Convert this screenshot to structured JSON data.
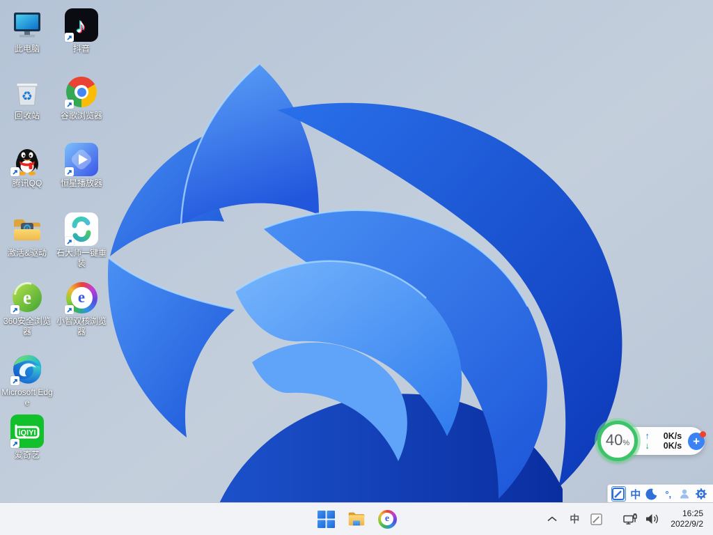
{
  "desktop": {
    "icons": [
      {
        "id": "this-pc",
        "label": "此电脑",
        "shortcut": false
      },
      {
        "id": "douyin",
        "label": "抖音",
        "shortcut": true
      },
      {
        "id": "recycle-bin",
        "label": "回收站",
        "shortcut": false
      },
      {
        "id": "chrome",
        "label": "谷歌浏览器",
        "shortcut": true
      },
      {
        "id": "qq",
        "label": "腾讯QQ",
        "shortcut": true
      },
      {
        "id": "star-player",
        "label": "恒星播放器",
        "shortcut": true
      },
      {
        "id": "activation-driver",
        "label": "激活&驱动",
        "shortcut": false
      },
      {
        "id": "shidashi",
        "label": "石大师一键重装",
        "shortcut": true
      },
      {
        "id": "360-browser",
        "label": "360安全浏览器",
        "shortcut": true,
        "glyph": "e"
      },
      {
        "id": "xiaozhi-browser",
        "label": "小智双核浏览器",
        "shortcut": true,
        "glyph": "e"
      },
      {
        "id": "edge",
        "label": "Microsoft Edge",
        "shortcut": true
      },
      {
        "id": "iqiyi",
        "label": "爱奇艺",
        "shortcut": true,
        "glyph": "iQIYI"
      }
    ]
  },
  "speed_widget": {
    "percent": "40",
    "unit": "%",
    "upload_arrow": "↑",
    "download_arrow": "↓",
    "upload_speed": "0K/s",
    "download_speed": "0K/s",
    "plus_label": "+"
  },
  "ime_bar": {
    "mode_chinese": "中",
    "punctuation": "°,"
  },
  "taskbar": {
    "browser_glyph": "e",
    "tray": {
      "ime_mode": "中"
    },
    "clock": {
      "time": "16:25",
      "date": "2022/9/2"
    }
  },
  "colors": {
    "bloom_blue": "#2268e8",
    "desktop_base": "#bcc9da",
    "taskbar_bg": "#f1f3f6",
    "widget_ring_green": "#3ec468",
    "accent_blue": "#3b82f4"
  }
}
